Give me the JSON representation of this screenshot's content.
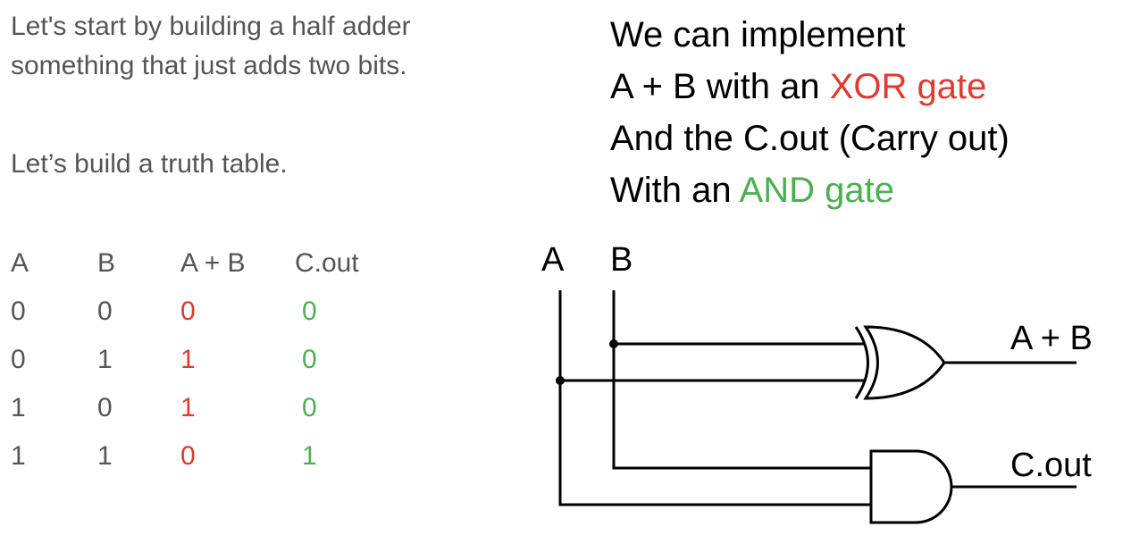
{
  "colors": {
    "text_gray": "#555555",
    "sum_red": "#e03a2f",
    "carry_green": "#4caf50",
    "black": "#000000"
  },
  "intro": {
    "line1": "Let's start by building a half adder",
    "line2": "something that just adds two bits.",
    "line3": "Let’s build a truth table."
  },
  "truth_table": {
    "headers": [
      "A",
      "B",
      "A + B",
      "C.out"
    ],
    "rows": [
      [
        "0",
        "0",
        "0",
        "0"
      ],
      [
        "0",
        "1",
        "1",
        "0"
      ],
      [
        "1",
        "0",
        "1",
        "0"
      ],
      [
        "1",
        "1",
        "0",
        "1"
      ]
    ]
  },
  "explanation": {
    "line1": "We can implement",
    "line2_pre": "A + B with an ",
    "line2_highlight": "XOR gate",
    "line3": "And the C.out (Carry out)",
    "line4_pre": "With an ",
    "line4_highlight": "AND gate"
  },
  "circuit": {
    "input_a": "A",
    "input_b": "B",
    "xor_output": "A + B",
    "and_output": "C.out",
    "gates": [
      "xor-gate",
      "and-gate"
    ]
  }
}
